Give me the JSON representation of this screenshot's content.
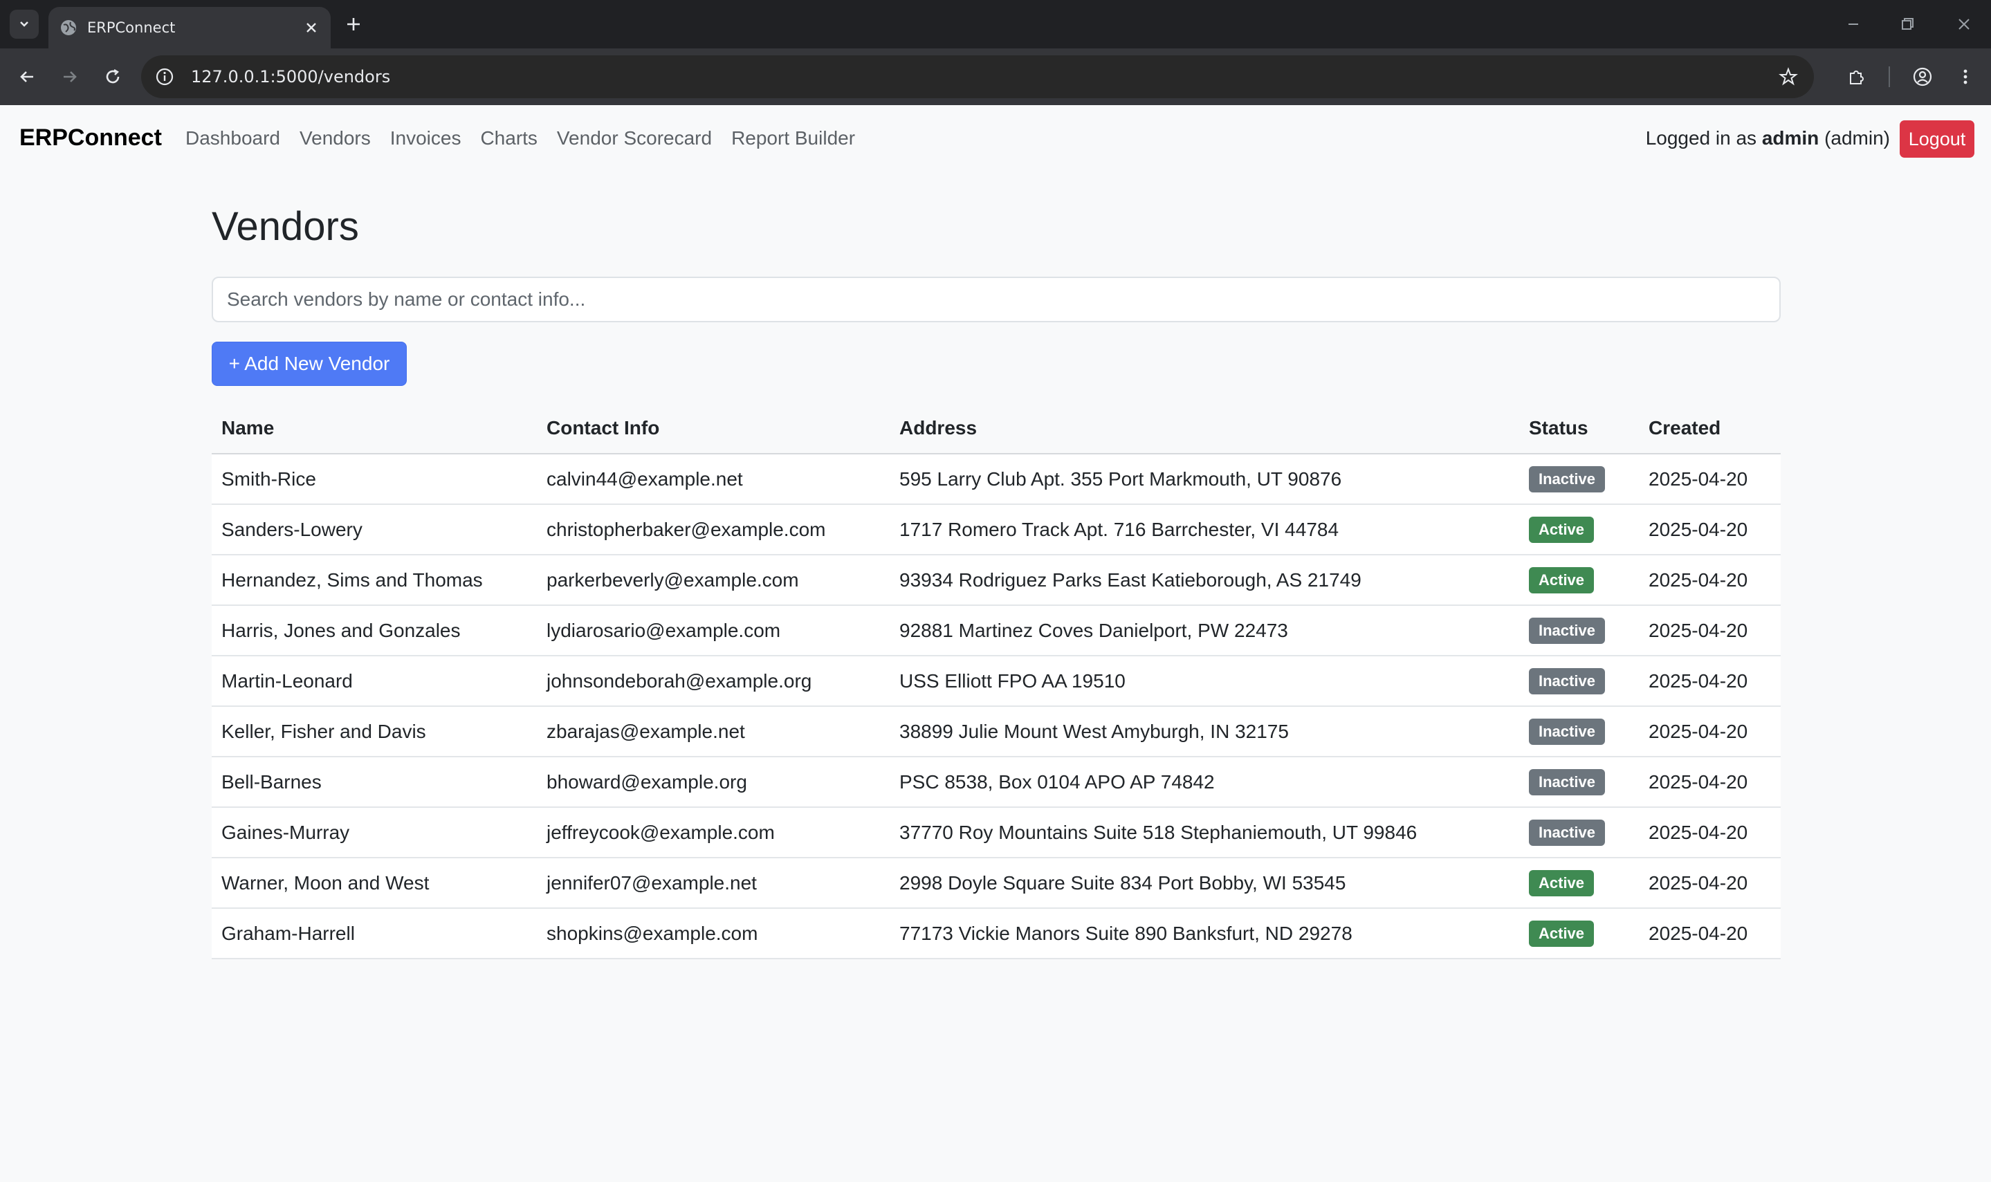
{
  "browser": {
    "tab_title": "ERPConnect",
    "url": "127.0.0.1:5000/vendors"
  },
  "nav": {
    "brand": "ERPConnect",
    "links": [
      "Dashboard",
      "Vendors",
      "Invoices",
      "Charts",
      "Vendor Scorecard",
      "Report Builder"
    ],
    "user_prefix": "Logged in as ",
    "username": "admin",
    "role": " (admin)",
    "logout": "Logout"
  },
  "page": {
    "title": "Vendors",
    "search_placeholder": "Search vendors by name or contact info...",
    "add_button": "+ Add New Vendor"
  },
  "table": {
    "columns": [
      "Name",
      "Contact Info",
      "Address",
      "Status",
      "Created"
    ],
    "rows": [
      {
        "name": "Smith-Rice",
        "contact": "calvin44@example.net",
        "address": "595 Larry Club Apt. 355 Port Markmouth, UT 90876",
        "status": "Inactive",
        "created": "2025-04-20"
      },
      {
        "name": "Sanders-Lowery",
        "contact": "christopherbaker@example.com",
        "address": "1717 Romero Track Apt. 716 Barrchester, VI 44784",
        "status": "Active",
        "created": "2025-04-20"
      },
      {
        "name": "Hernandez, Sims and Thomas",
        "contact": "parkerbeverly@example.com",
        "address": "93934 Rodriguez Parks East Katieborough, AS 21749",
        "status": "Active",
        "created": "2025-04-20"
      },
      {
        "name": "Harris, Jones and Gonzales",
        "contact": "lydiarosario@example.com",
        "address": "92881 Martinez Coves Danielport, PW 22473",
        "status": "Inactive",
        "created": "2025-04-20"
      },
      {
        "name": "Martin-Leonard",
        "contact": "johnsondeborah@example.org",
        "address": "USS Elliott FPO AA 19510",
        "status": "Inactive",
        "created": "2025-04-20"
      },
      {
        "name": "Keller, Fisher and Davis",
        "contact": "zbarajas@example.net",
        "address": "38899 Julie Mount West Amyburgh, IN 32175",
        "status": "Inactive",
        "created": "2025-04-20"
      },
      {
        "name": "Bell-Barnes",
        "contact": "bhoward@example.org",
        "address": "PSC 8538, Box 0104 APO AP 74842",
        "status": "Inactive",
        "created": "2025-04-20"
      },
      {
        "name": "Gaines-Murray",
        "contact": "jeffreycook@example.com",
        "address": "37770 Roy Mountains Suite 518 Stephaniemouth, UT 99846",
        "status": "Inactive",
        "created": "2025-04-20"
      },
      {
        "name": "Warner, Moon and West",
        "contact": "jennifer07@example.net",
        "address": "2998 Doyle Square Suite 834 Port Bobby, WI 53545",
        "status": "Active",
        "created": "2025-04-20"
      },
      {
        "name": "Graham-Harrell",
        "contact": "shopkins@example.com",
        "address": "77173 Vickie Manors Suite 890 Banksfurt, ND 29278",
        "status": "Active",
        "created": "2025-04-20"
      }
    ]
  },
  "colors": {
    "active": "#3f8a52",
    "inactive": "#6c757d",
    "primary": "#4f7af5",
    "danger": "#dc3545"
  }
}
